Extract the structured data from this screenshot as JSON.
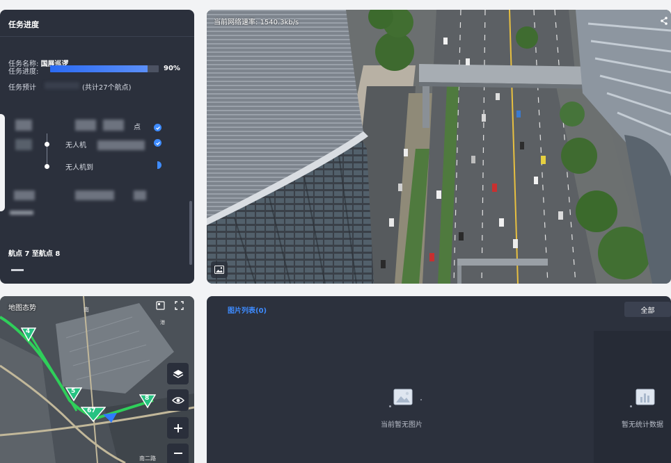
{
  "task_panel": {
    "title": "任务进度",
    "name_label": "任务名称:",
    "name_value": "国展巡逻",
    "progress_label": "任务进度:",
    "progress_fraction": 0.9,
    "progress_text": "90%",
    "eta_label": "任务预计",
    "eta_tail": "(共计27个航点)",
    "waypoints": [
      {
        "text": "点",
        "done": true
      },
      {
        "text": "无人机",
        "done": true
      },
      {
        "text": "无人机到",
        "done": false
      }
    ],
    "segment_label": "航点 7 至航点 8"
  },
  "video": {
    "speed_label": "当前网络速率:",
    "speed_value": "1540.3kb/s"
  },
  "map": {
    "title": "地图态势",
    "markers": [
      "4",
      "5",
      "67",
      "8"
    ],
    "controls": [
      "layers-icon",
      "eye-icon",
      "zoom-in-icon",
      "zoom-out-icon"
    ]
  },
  "pictures": {
    "title": "图片列表(0)",
    "filter_label": "全部",
    "empty_text": "当前暂无图片",
    "stats_empty_text": "暂无统计数据"
  },
  "colors": {
    "accent": "#3e8bff",
    "panel_bg": "#2b303c",
    "progress_fill": "#2b6af3"
  }
}
